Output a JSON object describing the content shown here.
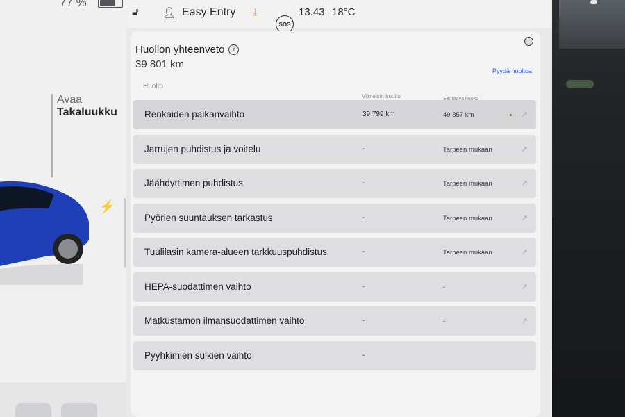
{
  "status": {
    "battery_percent": "77 %",
    "profile_name": "Easy Entry",
    "time": "13.43",
    "temperature": "18°C",
    "sos_label": "SOS"
  },
  "left_panel": {
    "trunk_action": "Avaa",
    "trunk_label": "Takaluukku"
  },
  "maintenance": {
    "title": "Huollon yhteenveto",
    "odometer": "39 801 km",
    "request_service_link": "Pyydä huoltoa",
    "columns": {
      "service": "Huolto",
      "last_service": "Viimeisin huolto",
      "next_service": "Seuraava huolto"
    },
    "items": [
      {
        "name": "Renkaiden paikanvaihto",
        "last": "39 799 km",
        "next": "49 857 km",
        "status_ok": true
      },
      {
        "name": "Jarrujen puhdistus ja voitelu",
        "last": "-",
        "next": "Tarpeen mukaan"
      },
      {
        "name": "Jäähdyttimen puhdistus",
        "last": "-",
        "next": "Tarpeen mukaan"
      },
      {
        "name": "Pyörien suuntauksen tarkastus",
        "last": "-",
        "next": "Tarpeen mukaan"
      },
      {
        "name": "Tuulilasin kamera-alueen tarkkuuspuhdistus",
        "last": "-",
        "next": "Tarpeen mukaan"
      },
      {
        "name": "HEPA-suodattimen vaihto",
        "last": "-",
        "next": "-"
      },
      {
        "name": "Matkustamon ilmansuodattimen vaihto",
        "last": "-",
        "next": "-"
      },
      {
        "name": "Pyyhkimien sulkien vaihto",
        "last": "-",
        "next": ""
      }
    ]
  },
  "colors": {
    "accent_link": "#3c63d9",
    "download_icon": "#e9a23b",
    "car_body": "#1f3fb8",
    "status_ok_dot": "#3b8e43"
  },
  "icons": {
    "lock": "lock-open-icon",
    "profile": "person-icon",
    "download": "download-icon",
    "charge": "lightning-icon",
    "info": "info-icon",
    "row_link": "arrow-up-right-icon"
  }
}
